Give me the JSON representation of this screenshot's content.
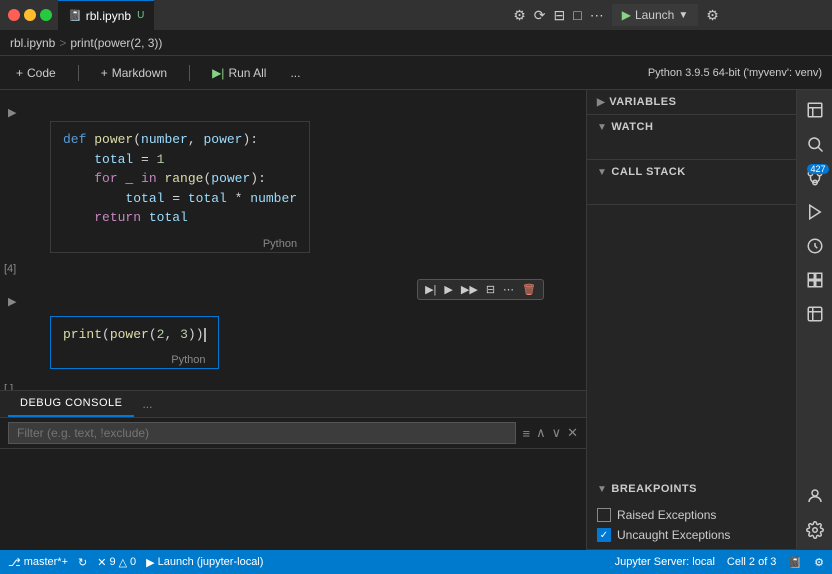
{
  "titleBar": {
    "tabFile": "rbl.ipynb",
    "tabIndicator": "U",
    "launchBtn": "Launch",
    "settingsTooltip": "Settings",
    "historyTooltip": "Source Control History",
    "splitTooltip": "Split Editor",
    "layoutTooltip": "Toggle Layout",
    "moreTooltip": "More"
  },
  "breadcrumb": {
    "file": "rbl.ipynb",
    "sep": ">",
    "func": "print(power(2, 3))"
  },
  "toolbar": {
    "addCode": "Code",
    "addMarkdown": "Markdown",
    "runAll": "Run All",
    "moreActions": "...",
    "kernelInfo": "Python 3.9.5 64-bit ('myvenv': venv)"
  },
  "cells": [
    {
      "id": "cell-1",
      "label": "[4]",
      "metaLang": "Python",
      "code": "def power(number, power):\n    total = 1\n    for _ in range(power):\n        total = total * number\n    return total"
    },
    {
      "id": "cell-2",
      "label": "[ ]",
      "metaLang": "Python",
      "code": "print(power(2, 3))",
      "active": true
    }
  ],
  "cellToolbar": {
    "executeAbove": "▶|",
    "executeCurrent": "▶",
    "executeBelow": "▶▶",
    "split": "⊟",
    "more": "⋯",
    "delete": "🗑"
  },
  "debugConsole": {
    "tabLabel": "DEBUG CONSOLE",
    "moreLabel": "...",
    "filterPlaceholder": "Filter (e.g. text, !exclude)"
  },
  "rightPanel": {
    "sections": [
      {
        "id": "variables",
        "label": "VARIABLES",
        "expanded": false
      },
      {
        "id": "watch",
        "label": "WATCH",
        "expanded": true
      },
      {
        "id": "callStack",
        "label": "CALL STACK",
        "expanded": true
      },
      {
        "id": "breakpoints",
        "label": "BREAKPOINTS",
        "expanded": true
      }
    ],
    "breakpoints": [
      {
        "id": "raised-exceptions",
        "label": "Raised Exceptions",
        "checked": false
      },
      {
        "id": "uncaught-exceptions",
        "label": "Uncaught Exceptions",
        "checked": true
      }
    ]
  },
  "rightSidebar": {
    "icons": [
      {
        "id": "explorer",
        "symbol": "⎘",
        "badge": null
      },
      {
        "id": "search",
        "symbol": "🔍",
        "badge": null
      },
      {
        "id": "source-control",
        "symbol": "⎇",
        "badge": "427"
      },
      {
        "id": "debug",
        "symbol": "▷",
        "badge": null
      },
      {
        "id": "run",
        "symbol": "⚙",
        "badge": null
      },
      {
        "id": "extensions",
        "symbol": "⊞",
        "badge": null
      },
      {
        "id": "jupyter",
        "symbol": "🧪",
        "badge": null
      },
      {
        "id": "person",
        "symbol": "👤",
        "badge": null
      },
      {
        "id": "settings",
        "symbol": "⚙",
        "badge": null
      }
    ]
  },
  "statusBar": {
    "gitBranch": "master*+",
    "syncIcon": "↻",
    "errors": "9",
    "warnings": "0",
    "launch": "Launch (jupyter-local)",
    "jupyterServer": "Jupyter Server: local",
    "cellInfo": "Cell 2 of 3",
    "notebookIcon": "📓",
    "settingsIcon": "⚙"
  }
}
